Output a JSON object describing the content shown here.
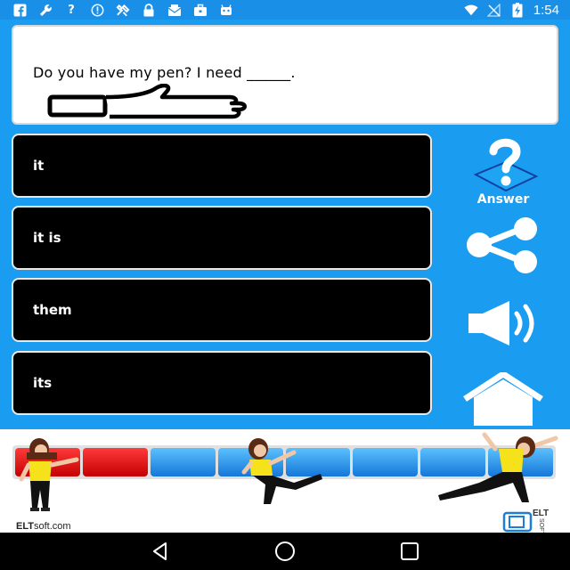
{
  "status_bar": {
    "time": "1:54",
    "icons_left": [
      "facebook-icon",
      "wrench-icon",
      "help-icon",
      "circle-info-icon",
      "tools-icon",
      "lock-icon",
      "mail-icon",
      "briefcase-icon",
      "robot-icon"
    ],
    "icons_right": [
      "wifi-icon",
      "signal-off-icon",
      "battery-charging-icon"
    ]
  },
  "question": {
    "text": "Do you have my pen? I need ______.",
    "image": "thumbs-up-icon"
  },
  "options": [
    {
      "label": "it"
    },
    {
      "label": "it is"
    },
    {
      "label": "them"
    },
    {
      "label": "its"
    }
  ],
  "side_buttons": {
    "answer_label": "Answer",
    "share": "share-icon",
    "sound": "speaker-icon",
    "home": "home-icon"
  },
  "progress": {
    "total_segments": 8,
    "completed_segments": 2
  },
  "branding": {
    "site_bold": "ELT",
    "site_rest": "soft.com",
    "logo_top": "ELT",
    "logo_side": "SOFT"
  },
  "colors": {
    "app_background": "#1a9cf0",
    "status_bar": "#1a8fe8",
    "option_background": "#000000",
    "progress_done": "#e00000",
    "progress_todo": "#2b96ec"
  },
  "nav": [
    "back-icon",
    "home-circle-icon",
    "recents-icon"
  ]
}
